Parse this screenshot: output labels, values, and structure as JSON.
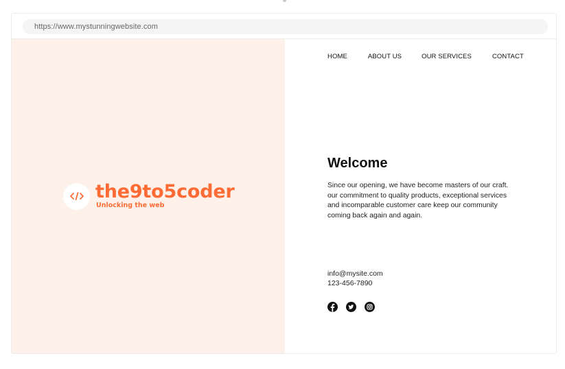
{
  "browser": {
    "url": "https://www.mystunningwebsite.com"
  },
  "brand": {
    "logo_icon": "code-brackets-icon",
    "name": "the9to5coder",
    "tagline": "Unlocking the web",
    "accent_color": "#ff6b35",
    "panel_color": "#fdf1e9"
  },
  "nav": {
    "items": [
      {
        "label": "HOME"
      },
      {
        "label": "ABOUT US"
      },
      {
        "label": "OUR SERVICES"
      },
      {
        "label": "CONTACT"
      }
    ]
  },
  "main": {
    "title": "Welcome",
    "body": "Since our opening, we have become masters of our craft. our commitment to quality products, exceptional services and incomparable customer care keep our community coming back again and again."
  },
  "contact": {
    "email": "info@mysite.com",
    "phone": "123-456-7890"
  },
  "socials": [
    {
      "icon": "facebook-icon"
    },
    {
      "icon": "twitter-icon"
    },
    {
      "icon": "instagram-icon"
    }
  ]
}
